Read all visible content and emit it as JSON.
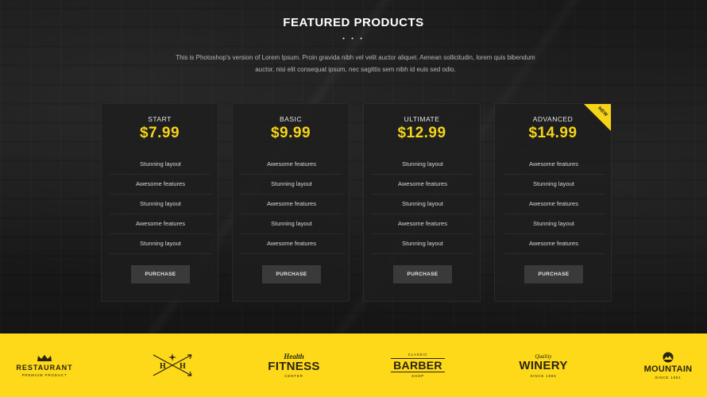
{
  "header": {
    "title": "FEATURED PRODUCTS",
    "dots": "• • •",
    "description_line1": "This is Photoshop's version  of Lorem Ipsum. Proin gravida nibh vel velit auctor aliquet. Aenean sollicitudin, lorem quis bibendum",
    "description_line2": "auctor, nisi elit consequat ipsum, nec sagittis sem nibh id euis sed odio."
  },
  "plans": [
    {
      "name": "START",
      "price": "$7.99",
      "features": [
        "Stunning layout",
        "Awesome features",
        "Stunning layout",
        "Awesome features",
        "Stunning layout"
      ],
      "button": "PURCHASE"
    },
    {
      "name": "BASIC",
      "price": "$9.99",
      "features": [
        "Awesome features",
        "Stunning layout",
        "Awesome features",
        "Stunning layout",
        "Awesome features"
      ],
      "button": "PURCHASE"
    },
    {
      "name": "ULTIMATE",
      "price": "$12.99",
      "features": [
        "Stunning layout",
        "Awesome features",
        "Stunning layout",
        "Awesome features",
        "Stunning layout"
      ],
      "button": "PURCHASE"
    },
    {
      "name": "ADVANCED",
      "price": "$14.99",
      "features": [
        "Awesome features",
        "Stunning layout",
        "Awesome features",
        "Stunning layout",
        "Awesome features"
      ],
      "button": "PURCHASE",
      "ribbon": "NEW"
    }
  ],
  "logos": [
    {
      "name": "RESTAURANT",
      "sub": "PREMIUM PRODUCT",
      "icon": "crown-icon"
    },
    {
      "name": "H ✕ H",
      "sub": "",
      "icon": "crossed-arrows-icon"
    },
    {
      "name_top": "Health",
      "name": "FITNESS",
      "sub": "CENTER"
    },
    {
      "name_top": "CLASSIC",
      "name": "BARBER",
      "sub": "SHOP"
    },
    {
      "name_top": "Quality",
      "name": "WINERY",
      "sub": "SINCE 1985"
    },
    {
      "name": "MOUNTAIN",
      "sub": "SINCE 1991",
      "icon": "mountain-icon"
    }
  ],
  "colors": {
    "accent": "#f6d418",
    "logo_band": "#fdd91a",
    "dark": "#1b1b1b"
  }
}
